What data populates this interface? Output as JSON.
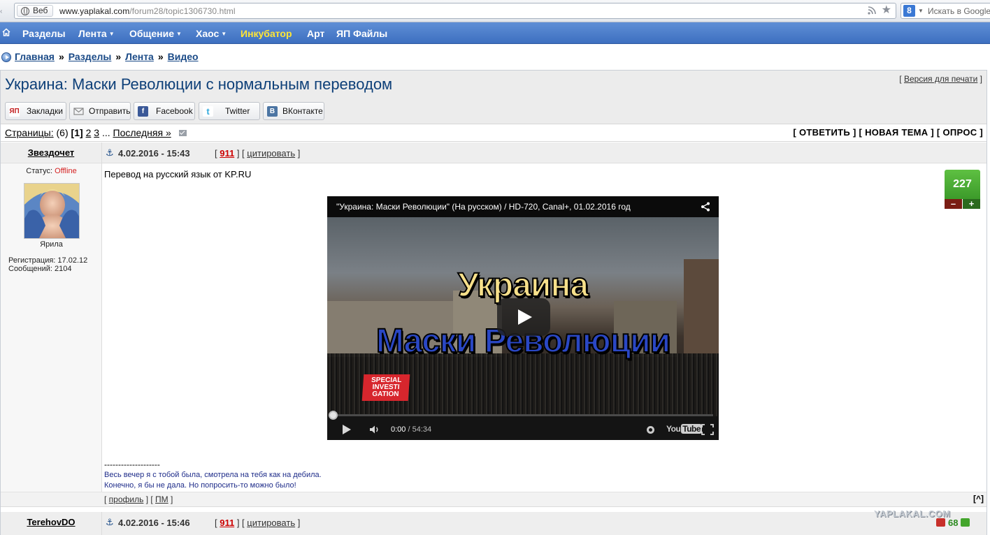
{
  "browser": {
    "web_chip": "Веб",
    "url_host": "www.yaplakal.com",
    "url_path": "/forum28/topic1306730.html",
    "search_engine_letter": "8",
    "search_placeholder": "Искать в Google"
  },
  "nav": {
    "items": [
      {
        "label": "Разделы",
        "dropdown": false
      },
      {
        "label": "Лента",
        "dropdown": true
      },
      {
        "label": "Общение",
        "dropdown": true
      },
      {
        "label": "Хаос",
        "dropdown": true
      },
      {
        "label": "Инкубатор",
        "dropdown": false,
        "highlight": "#ffe536"
      },
      {
        "label": "Арт",
        "dropdown": false
      },
      {
        "label": "ЯП Файлы",
        "dropdown": false
      }
    ]
  },
  "breadcrumb": {
    "items": [
      "Главная",
      "Разделы",
      "Лента",
      "Видео"
    ],
    "separator": "»"
  },
  "topic": {
    "title": "Украина: Маски Революции с нормальным переводом",
    "print_link": "Версия для печати",
    "share_buttons": [
      {
        "label": "Закладки",
        "icon": "yap-icon",
        "icon_text": "ЯП",
        "color": "#c32121"
      },
      {
        "label": "Отправить",
        "icon": "mail-icon",
        "icon_text": "",
        "color": "#888888"
      },
      {
        "label": "Facebook",
        "icon": "facebook-icon",
        "icon_text": "f",
        "color": "#3b5998"
      },
      {
        "label": "Twitter",
        "icon": "twitter-icon",
        "icon_text": "t",
        "color": "#33aadd"
      },
      {
        "label": "ВКонтакте",
        "icon": "vk-icon",
        "icon_text": "В",
        "color": "#4c75a3"
      }
    ],
    "pages": {
      "label": "Страницы:",
      "count": "(6)",
      "current": "1",
      "links": [
        "2",
        "3"
      ],
      "ellipsis": "...",
      "last": "Последняя »"
    },
    "actions": [
      "ОТВЕТИТЬ",
      "НОВАЯ ТЕМА",
      "ОПРОС"
    ]
  },
  "posts": [
    {
      "author": "Звездочет",
      "date": "4.02.2016 - 15:43",
      "post_number": "911",
      "quote_label": "цитировать",
      "status_label": "Статус:",
      "status_value": "Offline",
      "rank": "Ярила",
      "registration": "Регистрация: 17.02.12",
      "messages": "Сообщений: 2104",
      "text": "Перевод на русский язык от KP.RU",
      "rating": "227",
      "rating_minus": "–",
      "rating_plus": "+",
      "video": {
        "title": "\"Украина: Маски Революции\" (На русском) / HD-720, Canal+, 01.02.2016 год",
        "overlay_line1": "Украина",
        "overlay_line2": "Маски  Революции",
        "badge": "SPECIAL INVESTI GATION",
        "time_current": "0:00",
        "time_separator": " / ",
        "time_total": "54:34",
        "logo": "You",
        "logo_tube": "Tube",
        "progress": 0
      },
      "signature": {
        "dashes": "--------------------",
        "line1": "Весь вечер я с тобой была, смотрела на тебя как на дебила.",
        "line2": "Конечно, я бы не дала. Но попросить-то можно было!"
      },
      "footer_profile": "профиль",
      "footer_pm": "ПМ",
      "footer_top": "[^]"
    },
    {
      "author": "TerehovDO",
      "date": "4.02.2016 - 15:46",
      "post_number": "911",
      "quote_label": "цитировать",
      "rating": "68"
    }
  ],
  "watermark": "YAPLAKAL.COM"
}
